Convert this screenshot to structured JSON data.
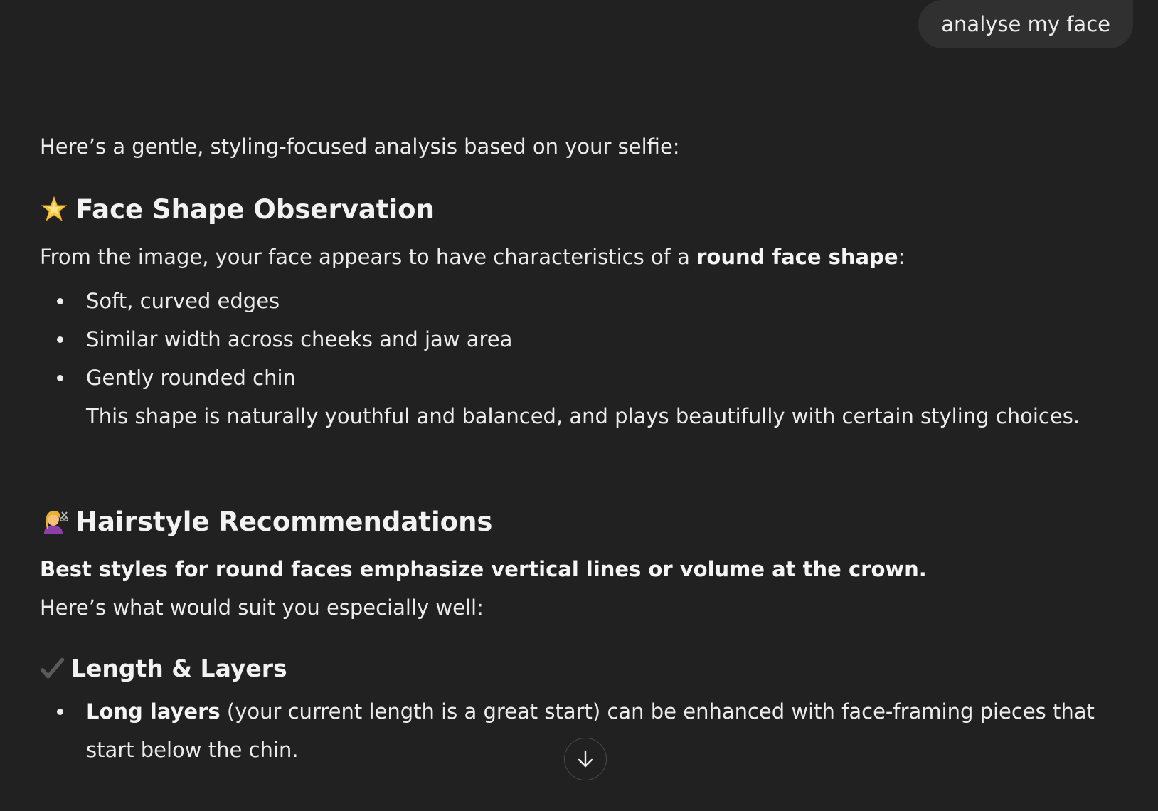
{
  "user_message": "analyse my face",
  "response": {
    "intro": "Here’s a gentle, styling-focused analysis based on your selfie:",
    "section1": {
      "emoji": "star-emoji",
      "heading": "Face Shape Observation",
      "lead_before": "From the image, your face appears to have characteristics of a ",
      "lead_bold": "round face shape",
      "lead_after": ":",
      "bullets": [
        "Soft, curved edges",
        "Similar width across cheeks and jaw area",
        "Gently rounded chin"
      ],
      "continuation": "This shape is naturally youthful and balanced, and plays beautifully with certain styling choices."
    },
    "section2": {
      "emoji": "haircut-emoji",
      "heading": "Hairstyle Recommendations",
      "bold_line": "Best styles for round faces emphasize vertical lines or volume at the crown.",
      "line": "Here’s what would suit you especially well:",
      "sub_heading": "Length & Layers",
      "sub_icon": "check-mark-icon",
      "bullet1_bold": "Long layers",
      "bullet1_rest": " (your current length is a great start) can be enhanced with face-framing pieces that",
      "bullet1_cont": "start below the chin."
    }
  },
  "scroll_button_icon": "arrow-down-icon"
}
